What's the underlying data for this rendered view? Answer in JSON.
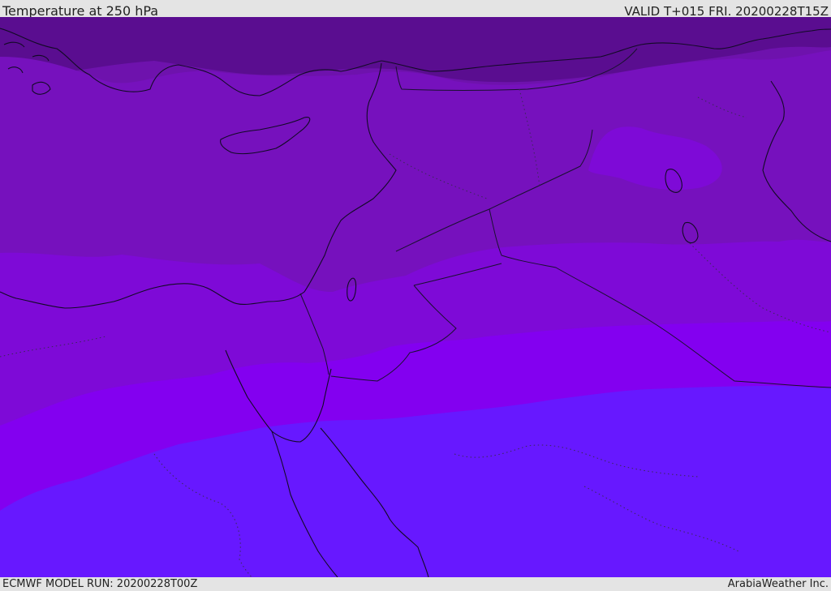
{
  "header": {
    "title": "Temperature at 250 hPa",
    "valid": "VALID T+015 FRI. 20200228T15Z"
  },
  "footer": {
    "model_run": "ECMWF MODEL RUN: 20200228T00Z",
    "credit": "ArabiaWeather Inc."
  },
  "map": {
    "field": "temperature",
    "level": "250 hPa",
    "color_bands": [
      "#5a0d90",
      "#6e12ad",
      "#7611bd",
      "#7e0ad7",
      "#8300f0",
      "#6718ff"
    ]
  }
}
